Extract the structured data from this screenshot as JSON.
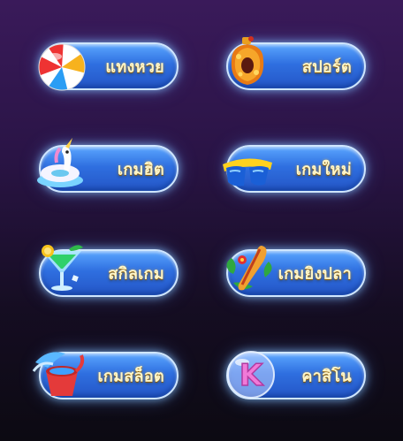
{
  "menu": [
    {
      "id": "lottery",
      "label": "แทงหวย",
      "icon": "beach-ball-icon"
    },
    {
      "id": "sports",
      "label": "สปอร์ต",
      "icon": "golden-vase-icon"
    },
    {
      "id": "hit-games",
      "label": "เกมฮิต",
      "icon": "unicorn-float-icon"
    },
    {
      "id": "new-games",
      "label": "เกมใหม่",
      "icon": "sunglasses-icon"
    },
    {
      "id": "skill-games",
      "label": "สกิลเกม",
      "icon": "cocktail-icon"
    },
    {
      "id": "fishing-games",
      "label": "เกมยิงปลา",
      "icon": "surfboard-icon"
    },
    {
      "id": "slot-games",
      "label": "เกมสล็อต",
      "icon": "water-bucket-icon"
    },
    {
      "id": "casino",
      "label": "คาสิโน",
      "icon": "letter-k-bubble-icon"
    }
  ]
}
